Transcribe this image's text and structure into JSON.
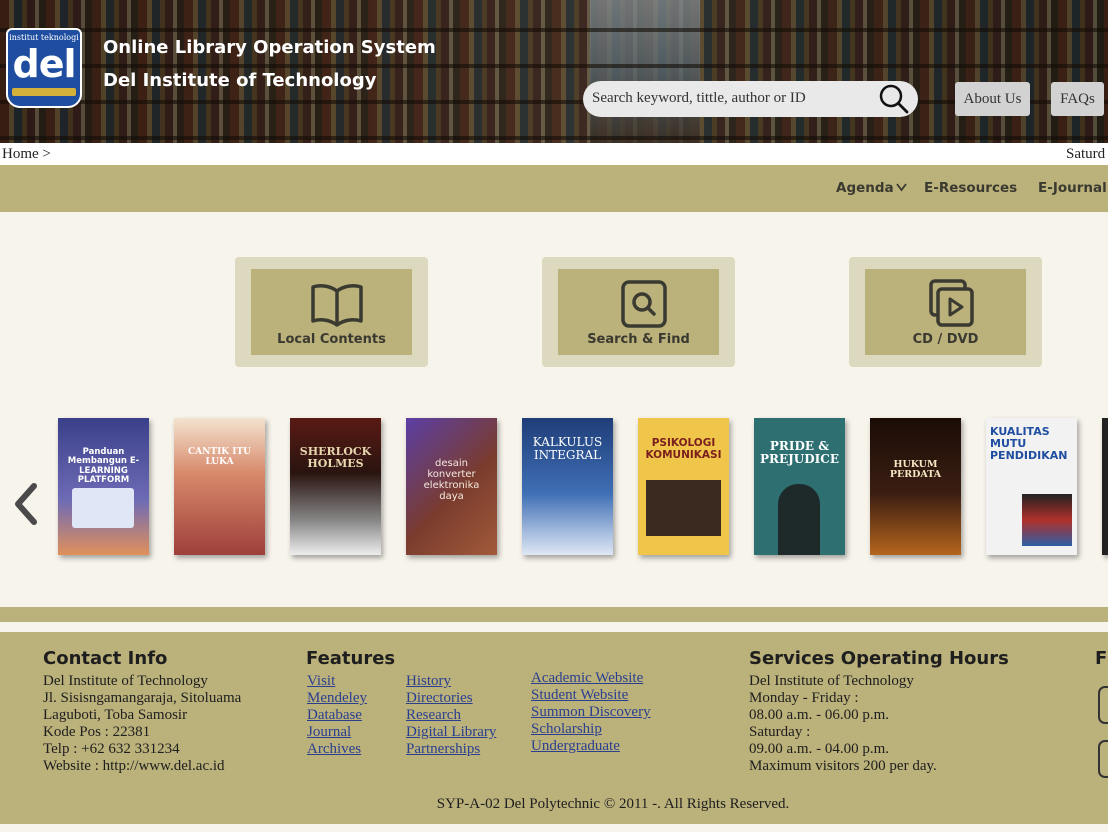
{
  "header": {
    "logo_text_top": "institut teknologi",
    "logo_text_main": "del",
    "title_line1": "Online Library Operation System",
    "title_line2": "Del Institute of Technology",
    "search_placeholder": "Search keyword, tittle, author or ID",
    "about_label": "About Us",
    "faq_label": "FAQs"
  },
  "breadcrumb": {
    "home": "Home >",
    "date": "Saturd"
  },
  "nav": {
    "items": [
      "Agenda",
      "E-Resources",
      "E-Journal"
    ]
  },
  "quick_links": [
    {
      "label": "Local Contents",
      "icon": "open-book-icon"
    },
    {
      "label": "Search & Find",
      "icon": "search-icon"
    },
    {
      "label": "CD / DVD",
      "icon": "media-play-icon"
    }
  ],
  "books": [
    {
      "title": "Panduan Membangun E-LEARNING PLATFORM",
      "color": "#6e6bb5"
    },
    {
      "title": "CANTIK ITU LUKA",
      "color": "#b5584a"
    },
    {
      "title": "SHERLOCK HOLMES",
      "color": "#2a2a2a"
    },
    {
      "title": "desain konverter elektronika daya",
      "color": "#7a3c2e"
    },
    {
      "title": "KALKULUS INTEGRAL",
      "color": "#2f4f8a"
    },
    {
      "title": "PSIKOLOGI KOMUNIKASI",
      "color": "#f0c64a"
    },
    {
      "title": "PRIDE & PREJUDICE",
      "color": "#2e6f72"
    },
    {
      "title": "HUKUM PERDATA",
      "color": "#3b1e12"
    },
    {
      "title": "KUALITAS MUTU PENDIDIKAN",
      "color": "#f2f2f2"
    }
  ],
  "footer": {
    "contact": {
      "heading": "Contact Info",
      "lines": [
        "Del Institute of Technology",
        "Jl. Sisisngamangaraja, Sitoluama",
        "Laguboti, Toba Samosir",
        "Kode Pos : 22381",
        "Telp : +62  632 331234",
        "Website : http://www.del.ac.id"
      ]
    },
    "features": {
      "heading": "Features",
      "col1": [
        "Visit",
        "Mendeley",
        "Database",
        "Journal",
        "Archives"
      ],
      "col2": [
        "History",
        "Directories",
        "Research",
        "Digital Library",
        "Partnerships"
      ],
      "col3": [
        "Academic Website",
        "Student Website",
        "Summon Discovery",
        "Scholarship",
        "Undergraduate"
      ]
    },
    "hours": {
      "heading": "Services Operating Hours",
      "lines": [
        "Del Institute of Technology",
        "Monday - Friday :",
        "08.00 a.m. - 06.00 p.m.",
        "Saturday :",
        "09.00 a.m. - 04.00 p.m.",
        "Maximum visitors 200 per day."
      ]
    },
    "follow_heading": "F",
    "copyright": "SYP-A-02 Del Polytechnic © 2011 -. All Rights Reserved."
  },
  "colors": {
    "accent": "#bbb17b",
    "link": "#2b3f8f"
  }
}
